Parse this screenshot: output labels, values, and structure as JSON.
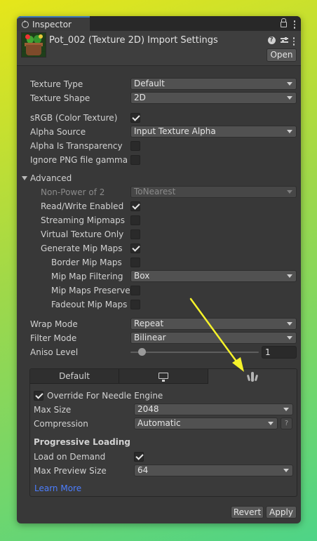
{
  "tab": {
    "title": "Inspector"
  },
  "header": {
    "title": "Pot_002 (Texture 2D) Import Settings",
    "open_label": "Open"
  },
  "fields": {
    "texture_type": {
      "label": "Texture Type",
      "value": "Default"
    },
    "texture_shape": {
      "label": "Texture Shape",
      "value": "2D"
    },
    "srgb": {
      "label": "sRGB (Color Texture)",
      "checked": true
    },
    "alpha_source": {
      "label": "Alpha Source",
      "value": "Input Texture Alpha"
    },
    "alpha_is_transparency": {
      "label": "Alpha Is Transparency",
      "checked": false
    },
    "ignore_png_gamma": {
      "label": "Ignore PNG file gamma",
      "checked": false
    }
  },
  "advanced": {
    "label": "Advanced",
    "non_power_of_2": {
      "label": "Non-Power of 2",
      "value": "ToNearest"
    },
    "read_write": {
      "label": "Read/Write Enabled",
      "checked": true
    },
    "streaming_mipmaps": {
      "label": "Streaming Mipmaps",
      "checked": false
    },
    "virtual_texture_only": {
      "label": "Virtual Texture Only",
      "checked": false
    },
    "generate_mip_maps": {
      "label": "Generate Mip Maps",
      "checked": true
    },
    "border_mip_maps": {
      "label": "Border Mip Maps",
      "checked": false
    },
    "mip_map_filtering": {
      "label": "Mip Map Filtering",
      "value": "Box"
    },
    "mip_maps_preserve": {
      "label": "Mip Maps Preserve",
      "checked": false
    },
    "fadeout_mip_maps": {
      "label": "Fadeout Mip Maps",
      "checked": false
    }
  },
  "wrap_mode": {
    "label": "Wrap Mode",
    "value": "Repeat"
  },
  "filter_mode": {
    "label": "Filter Mode",
    "value": "Bilinear"
  },
  "aniso_level": {
    "label": "Aniso Level",
    "value": "1"
  },
  "platform": {
    "tabs": [
      {
        "label": "Default",
        "icon": ""
      },
      {
        "label": "",
        "icon": "monitor-icon"
      },
      {
        "label": "",
        "icon": "needle-engine-icon"
      }
    ],
    "override": {
      "label": "Override For Needle Engine",
      "checked": true
    },
    "max_size": {
      "label": "Max Size",
      "value": "2048"
    },
    "compression": {
      "label": "Compression",
      "value": "Automatic",
      "help": "?"
    },
    "progressive_loading": {
      "heading": "Progressive Loading"
    },
    "load_on_demand": {
      "label": "Load on Demand",
      "checked": true
    },
    "max_preview_size": {
      "label": "Max Preview Size",
      "value": "64"
    },
    "learn_more": "Learn More"
  },
  "footer": {
    "revert_label": "Revert",
    "apply_label": "Apply"
  },
  "colors": {
    "accent": "#3a79bb",
    "link": "#4c7eff",
    "annotation_arrow": "#f5f22a"
  }
}
